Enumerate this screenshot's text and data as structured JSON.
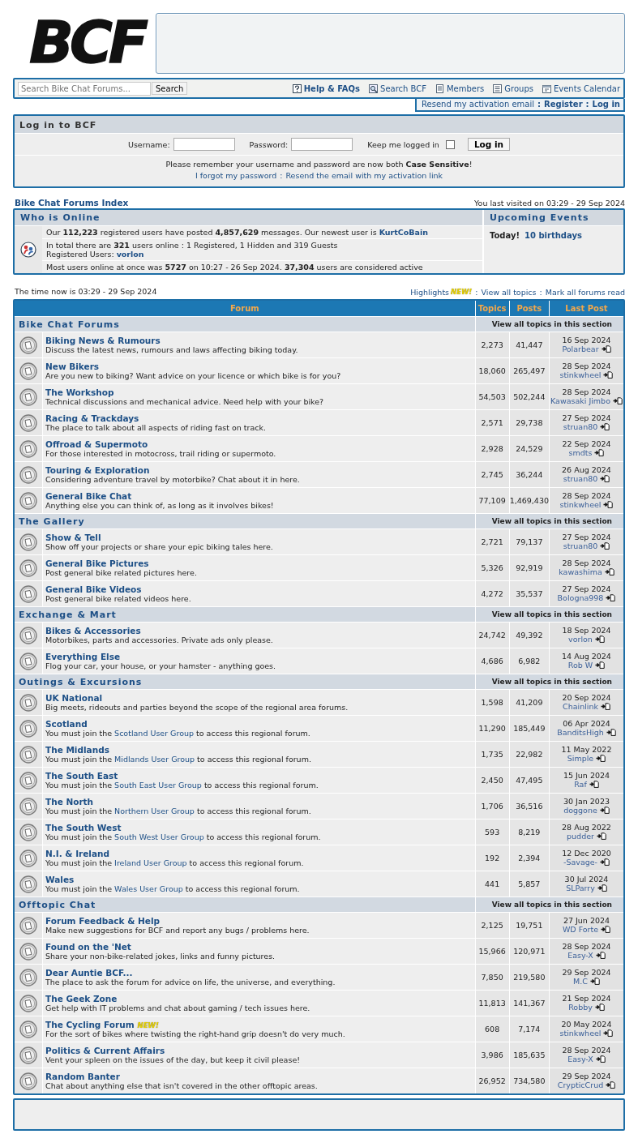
{
  "logo": {
    "text": "BCF"
  },
  "nav": {
    "search_placeholder": "Search Bike Chat Forums...",
    "search_button": "Search",
    "links": [
      {
        "label": "Help & FAQs",
        "bold": true
      },
      {
        "label": "Search BCF",
        "bold": false
      },
      {
        "label": "Members",
        "bold": false
      },
      {
        "label": "Groups",
        "bold": false
      },
      {
        "label": "Events Calendar",
        "bold": false
      }
    ]
  },
  "account": {
    "separator": ":",
    "links": [
      {
        "label": "Resend my activation email",
        "bold": false
      },
      {
        "label": "Register",
        "bold": true
      },
      {
        "label": "Log in",
        "bold": true
      }
    ]
  },
  "login": {
    "title": "Log in to BCF",
    "username_label": "Username:",
    "password_label": "Password:",
    "remember_label": "Keep me logged in",
    "remember_checked": false,
    "button": "Log in",
    "note": "Please remember your username and password are now both **Case Sensitive**!",
    "separator": ":",
    "links": [
      "I forgot my password",
      "Resend the email with my activation link"
    ]
  },
  "breadcrumb": "Bike Chat Forums Index",
  "last_visit": "You last visited on 03:29 - 29 Sep 2024",
  "online": {
    "title": "Who is Online",
    "stats": {
      "text": "Our **112,223** registered users have posted **4,857,629** messages. Our newest user is",
      "link": "KurtCoBain"
    },
    "total": "In total there are **321** users online : 1 Registered, 1 Hidden and 319 Guests",
    "registered": {
      "text": "Registered Users:",
      "link": "vorlon"
    },
    "record": "Most users online at once was **5727** on 10:27 - 26 Sep 2024. **37,304** users are considered active",
    "events_title": "Upcoming Events",
    "events_label": "Today!",
    "events_link": "10 birthdays"
  },
  "time_now": "The time now is 03:29 - 29 Sep 2024",
  "quick_links": {
    "separator": ":",
    "links": [
      {
        "label": "Highlights",
        "badge": "NEW!"
      },
      {
        "label": "View all topics"
      },
      {
        "label": "Mark all forums read"
      }
    ]
  },
  "table": {
    "columns": [
      "Forum",
      "Topics",
      "Posts",
      "Last Post"
    ],
    "sections": [
      {
        "title": "Bike Chat Forums",
        "view_all": "View all topics in this section",
        "forums": [
          {
            "name": "Biking News & Rumours",
            "kind": "plain",
            "description": "Discuss the latest news, rumours and laws affecting biking today.",
            "topics": "2,273",
            "posts": "41,447",
            "last_date": "16 Sep 2024",
            "last_user": "Polarbear"
          },
          {
            "name": "New Bikers",
            "kind": "plain",
            "description": "Are you new to biking? Want advice on your licence or which bike is for you?",
            "topics": "18,060",
            "posts": "265,497",
            "last_date": "28 Sep 2024",
            "last_user": "stinkwheel"
          },
          {
            "name": "The Workshop",
            "kind": "plain",
            "description": "Technical discussions and mechanical advice. Need help with your bike?",
            "topics": "54,503",
            "posts": "502,244",
            "last_date": "28 Sep 2024",
            "last_user": "Kawasaki Jimbo"
          },
          {
            "name": "Racing & Trackdays",
            "kind": "plain",
            "description": "The place to talk about all aspects of riding fast on track.",
            "topics": "2,571",
            "posts": "29,738",
            "last_date": "27 Sep 2024",
            "last_user": "struan80"
          },
          {
            "name": "Offroad & Supermoto",
            "kind": "plain",
            "description": "For those interested in motocross, trail riding or supermoto.",
            "topics": "2,928",
            "posts": "24,529",
            "last_date": "22 Sep 2024",
            "last_user": "smdts"
          },
          {
            "name": "Touring & Exploration",
            "kind": "plain",
            "description": "Considering adventure travel by motorbike? Chat about it in here.",
            "topics": "2,745",
            "posts": "36,244",
            "last_date": "26 Aug 2024",
            "last_user": "struan80"
          },
          {
            "name": "General Bike Chat",
            "kind": "plain",
            "description": "Anything else you can think of, as long as it involves bikes!",
            "topics": "77,109",
            "posts": "1,469,430",
            "last_date": "28 Sep 2024",
            "last_user": "stinkwheel"
          }
        ]
      },
      {
        "title": "The Gallery",
        "view_all": "View all topics in this section",
        "forums": [
          {
            "name": "Show & Tell",
            "kind": "plain",
            "description": "Show off your projects or share your epic biking tales here.",
            "topics": "2,721",
            "posts": "79,137",
            "last_date": "27 Sep 2024",
            "last_user": "struan80"
          },
          {
            "name": "General Bike Pictures",
            "kind": "plain",
            "description": "Post general bike related pictures here.",
            "topics": "5,326",
            "posts": "92,919",
            "last_date": "28 Sep 2024",
            "last_user": "kawashima"
          },
          {
            "name": "General Bike Videos",
            "kind": "plain",
            "description": "Post general bike related videos here.",
            "topics": "4,272",
            "posts": "35,537",
            "last_date": "27 Sep 2024",
            "last_user": "Bologna998"
          }
        ]
      },
      {
        "title": "Exchange & Mart",
        "view_all": "View all topics in this section",
        "forums": [
          {
            "name": "Bikes & Accessories",
            "kind": "plain",
            "description": "Motorbikes, parts and accessories. Private ads only please.",
            "topics": "24,742",
            "posts": "49,392",
            "last_date": "18 Sep 2024",
            "last_user": "vorlon"
          },
          {
            "name": "Everything Else",
            "kind": "plain",
            "description": "Flog your car, your house, or your hamster - anything goes.",
            "topics": "4,686",
            "posts": "6,982",
            "last_date": "14 Aug 2024",
            "last_user": "Rob W"
          }
        ]
      },
      {
        "title": "Outings & Excursions",
        "view_all": "View all topics in this section",
        "forums": [
          {
            "name": "UK National",
            "kind": "plain",
            "description": "Big meets, rideouts and parties beyond the scope of the regional area forums.",
            "topics": "1,598",
            "posts": "41,209",
            "last_date": "20 Sep 2024",
            "last_user": "Chainlink"
          },
          {
            "name": "Scotland",
            "kind": "restricted",
            "join_text": "You must join the",
            "group_link": "Scotland User Group",
            "join_suffix": "to access this regional forum.",
            "topics": "11,290",
            "posts": "185,449",
            "last_date": "06 Apr 2024",
            "last_user": "BanditsHigh"
          },
          {
            "name": "The Midlands",
            "kind": "restricted",
            "join_text": "You must join the",
            "group_link": "Midlands User Group",
            "join_suffix": "to access this regional forum.",
            "topics": "1,735",
            "posts": "22,982",
            "last_date": "11 May 2022",
            "last_user": "Simple"
          },
          {
            "name": "The South East",
            "kind": "restricted",
            "join_text": "You must join the",
            "group_link": "South East User Group",
            "join_suffix": "to access this regional forum.",
            "topics": "2,450",
            "posts": "47,495",
            "last_date": "15 Jun 2024",
            "last_user": "Raf"
          },
          {
            "name": "The North",
            "kind": "restricted",
            "join_text": "You must join the",
            "group_link": "Northern User Group",
            "join_suffix": "to access this regional forum.",
            "topics": "1,706",
            "posts": "36,516",
            "last_date": "30 Jan 2023",
            "last_user": "doggone"
          },
          {
            "name": "The South West",
            "kind": "restricted",
            "join_text": "You must join the",
            "group_link": "South West User Group",
            "join_suffix": "to access this regional forum.",
            "topics": "593",
            "posts": "8,219",
            "last_date": "28 Aug 2022",
            "last_user": "pudder"
          },
          {
            "name": "N.I. & Ireland",
            "kind": "restricted",
            "join_text": "You must join the",
            "group_link": "Ireland User Group",
            "join_suffix": "to access this regional forum.",
            "topics": "192",
            "posts": "2,394",
            "last_date": "12 Dec 2020",
            "last_user": "-Savage-"
          },
          {
            "name": "Wales",
            "kind": "restricted",
            "join_text": "You must join the",
            "group_link": "Wales User Group",
            "join_suffix": "to access this regional forum.",
            "topics": "441",
            "posts": "5,857",
            "last_date": "30 Jul 2024",
            "last_user": "SLParry"
          }
        ]
      },
      {
        "title": "Offtopic Chat",
        "view_all": "View all topics in this section",
        "forums": [
          {
            "name": "Forum Feedback & Help",
            "kind": "plain",
            "description": "Make new suggestions for BCF and report any bugs / problems here.",
            "topics": "2,125",
            "posts": "19,751",
            "last_date": "27 Jun 2024",
            "last_user": "WD Forte"
          },
          {
            "name": "Found on the 'Net",
            "kind": "plain",
            "description": "Share your non-bike-related jokes, links and funny pictures.",
            "topics": "15,966",
            "posts": "120,971",
            "last_date": "28 Sep 2024",
            "last_user": "Easy-X"
          },
          {
            "name": "Dear Auntie BCF...",
            "kind": "plain",
            "description": "The place to ask the forum for advice on life, the universe, and everything.",
            "topics": "7,850",
            "posts": "219,580",
            "last_date": "29 Sep 2024",
            "last_user": "M.C"
          },
          {
            "name": "The Geek Zone",
            "kind": "plain",
            "description": "Get help with IT problems and chat about gaming / tech issues here.",
            "topics": "11,813",
            "posts": "141,367",
            "last_date": "21 Sep 2024",
            "last_user": "Robby"
          },
          {
            "name": "The Cycling Forum",
            "kind": "plain",
            "badge": "NEW!",
            "description": "For the sort of bikes where twisting the right-hand grip doesn't do very much.",
            "topics": "608",
            "posts": "7,174",
            "last_date": "20 May 2024",
            "last_user": "stinkwheel"
          },
          {
            "name": "Politics & Current Affairs",
            "kind": "plain",
            "description": "Vent your spleen on the issues of the day, but keep it civil please!",
            "topics": "3,986",
            "posts": "185,635",
            "last_date": "28 Sep 2024",
            "last_user": "Easy-X"
          },
          {
            "name": "Random Banter",
            "kind": "plain",
            "description": "Chat about anything else that isn't covered in the other offtopic areas.",
            "topics": "26,952",
            "posts": "734,580",
            "last_date": "29 Sep 2024",
            "last_user": "CrypticCrud"
          }
        ]
      }
    ]
  }
}
